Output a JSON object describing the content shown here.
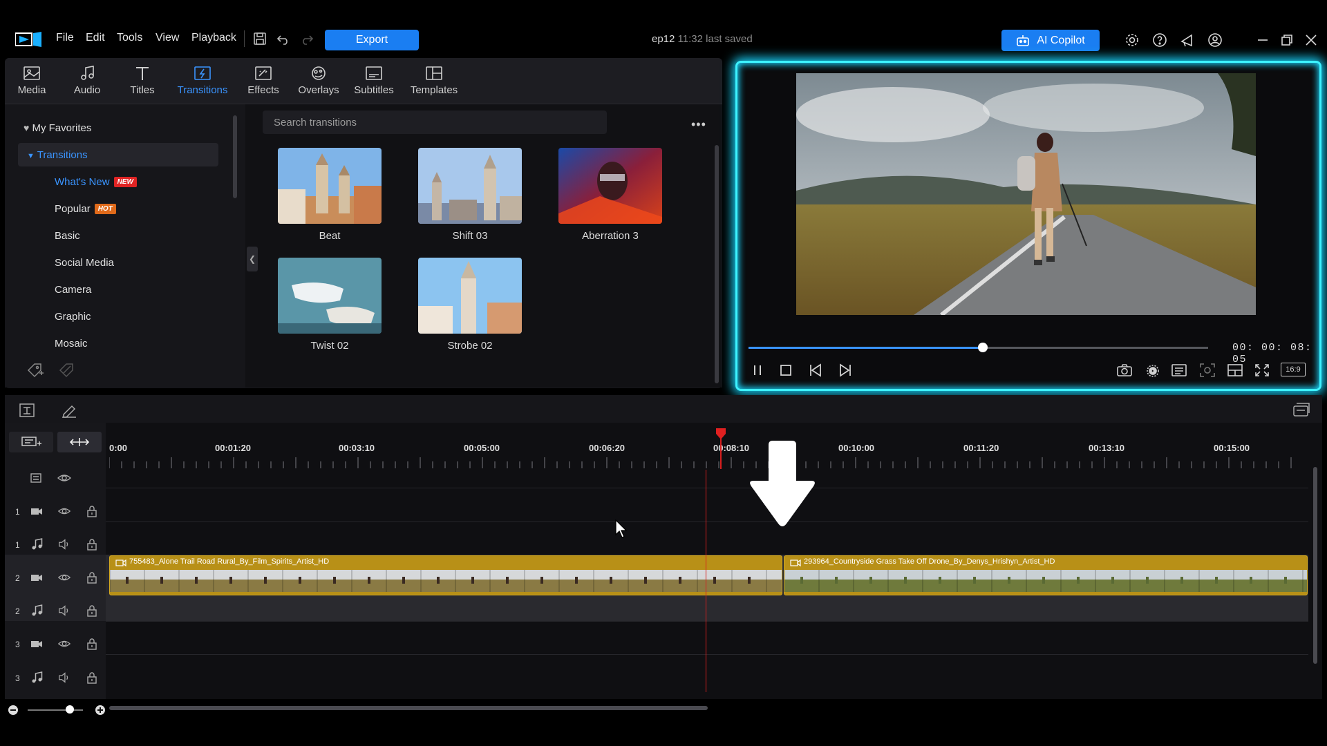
{
  "app": {
    "menu": [
      "File",
      "Edit",
      "Tools",
      "View",
      "Playback"
    ],
    "export_label": "Export",
    "project_name": "ep12",
    "saved_status": "11:32 last saved",
    "copilot_label": "AI Copilot",
    "accent": "#1a7ef2"
  },
  "library": {
    "tabs": [
      {
        "label": "Media",
        "icon": "media-icon"
      },
      {
        "label": "Audio",
        "icon": "music-note-icon"
      },
      {
        "label": "Titles",
        "icon": "title-t-icon"
      },
      {
        "label": "Transitions",
        "icon": "transitions-icon",
        "active": true
      },
      {
        "label": "Effects",
        "icon": "effects-icon"
      },
      {
        "label": "Overlays",
        "icon": "overlays-icon"
      },
      {
        "label": "Subtitles",
        "icon": "subtitles-icon"
      },
      {
        "label": "Templates",
        "icon": "templates-icon"
      }
    ],
    "sidebar": {
      "favorites": "My Favorites",
      "category": "Transitions",
      "items": [
        {
          "label": "What's New",
          "badge": "NEW"
        },
        {
          "label": "Popular",
          "badge": "HOT"
        },
        {
          "label": "Basic"
        },
        {
          "label": "Social Media"
        },
        {
          "label": "Camera"
        },
        {
          "label": "Graphic"
        },
        {
          "label": "Mosaic"
        }
      ]
    },
    "search_placeholder": "Search transitions",
    "thumbnails": [
      "Beat",
      "Shift 03",
      "Aberration 3",
      "Twist 02",
      "Strobe 02"
    ]
  },
  "preview": {
    "timecode": "00: 00: 08: 05",
    "progress": 0.51,
    "aspect": "16:9",
    "glow_color": "#3df2ff"
  },
  "timeline": {
    "ruler": [
      "0:00",
      "00:01:20",
      "00:03:10",
      "00:05:00",
      "00:06:20",
      "00:08:10",
      "00:10:00",
      "00:11:20",
      "00:13:10",
      "00:15:00"
    ],
    "tracks": [
      {
        "num": "1",
        "type": "video"
      },
      {
        "num": "1",
        "type": "audio"
      },
      {
        "num": "2",
        "type": "video"
      },
      {
        "num": "2",
        "type": "audio"
      },
      {
        "num": "3",
        "type": "video"
      },
      {
        "num": "3",
        "type": "audio"
      }
    ],
    "clips": [
      {
        "title": "755483_Alone Trail Road Rural_By_Film_Spirits_Artist_HD"
      },
      {
        "title": "293964_Countryside Grass Take Off Drone_By_Denys_Hrishyn_Artist_HD"
      }
    ],
    "clip_color": "#b89017"
  }
}
